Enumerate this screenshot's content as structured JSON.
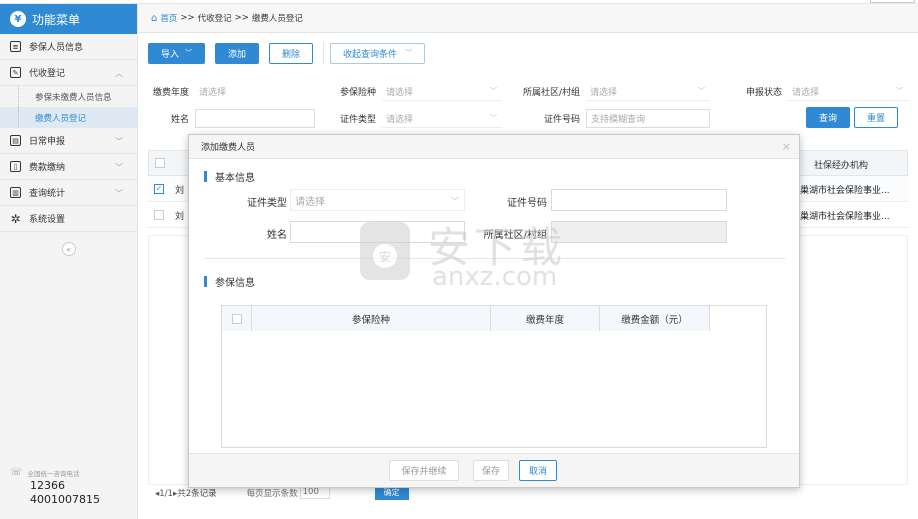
{
  "sidebar": {
    "title": "功能菜单",
    "items": [
      {
        "label": "参保人员信息"
      },
      {
        "label": "代收登记"
      },
      {
        "label": "日常申报"
      },
      {
        "label": "费款缴纳"
      },
      {
        "label": "查询统计"
      },
      {
        "label": "系统设置"
      }
    ],
    "subitems": [
      "参保未缴费人员信息",
      "缴费人员登记"
    ],
    "hotline_label": "全国统一咨询电话",
    "hotline_1": "12366",
    "hotline_2": "4001007815"
  },
  "breadcrumb": {
    "home": "首页",
    "sep": ">>",
    "level1": "代收登记",
    "level2": "缴费人员登记"
  },
  "toolbar": {
    "import": "导入",
    "add": "添加",
    "delete": "删除",
    "collapse_query": "收起查询条件"
  },
  "filters": {
    "year_label": "缴费年度",
    "year_ph": "请选择",
    "insurance_label": "参保险种",
    "insurance_ph": "请选择",
    "community_label": "所属社区/村组",
    "community_ph": "请选择",
    "status_label": "申报状态",
    "status_ph": "请选择",
    "name_label": "姓名",
    "idtype_label": "证件类型",
    "idtype_ph": "请选择",
    "idno_label": "证件号码",
    "idno_ph": "支持模糊查询",
    "search": "查询",
    "reset": "重置"
  },
  "table": {
    "agency_header": "社保经办机构",
    "rows": [
      {
        "name": "刘",
        "agency": "巢湖市社会保险事业..."
      },
      {
        "name": "刘",
        "agency": "巢湖市社会保险事业..."
      }
    ]
  },
  "pager": {
    "info": "◂1/1▸共2条记录",
    "per_page_label": "每页显示条数",
    "per_page": "100",
    "ok": "确定"
  },
  "modal": {
    "title": "添加缴费人员",
    "basic_section": "基本信息",
    "idtype_label": "证件类型",
    "idtype_ph": "请选择",
    "idno_label": "证件号码",
    "name_label": "姓名",
    "community_label": "所属社区/村组",
    "insured_section": "参保信息",
    "grid_headers": [
      "参保险种",
      "缴费年度",
      "缴费金额（元）"
    ],
    "save_continue": "保存并继续",
    "save": "保存",
    "cancel": "取消"
  },
  "watermark": {
    "cn": "安下载",
    "en": "anxz.com"
  },
  "colors": {
    "accent": "#2f8ad3"
  }
}
